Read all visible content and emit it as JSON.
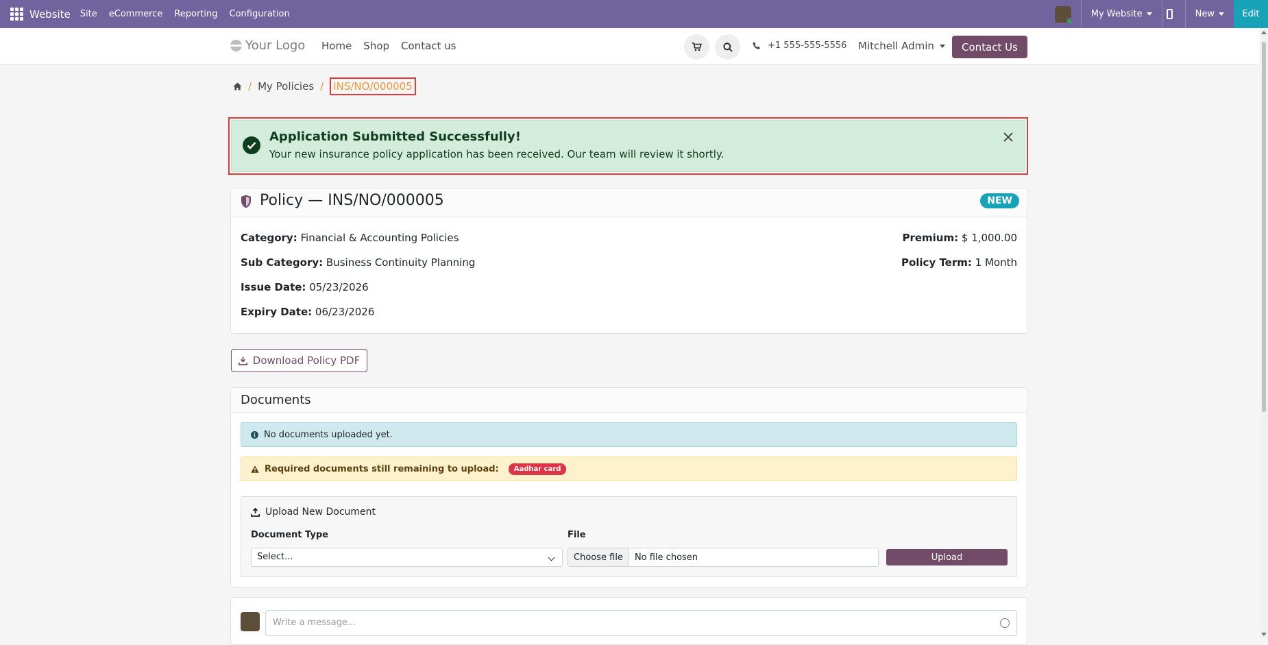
{
  "topbar": {
    "brand": "Website",
    "menu": [
      "Site",
      "eCommerce",
      "Reporting",
      "Configuration"
    ],
    "my_website": "My Website",
    "new": "New",
    "edit": "Edit",
    "bg_color": "#71639e"
  },
  "header": {
    "logo_text": "Your Logo",
    "nav": [
      "Home",
      "Shop",
      "Contact us"
    ],
    "phone": "+1 555-555-5556",
    "user": "Mitchell Admin",
    "contact_btn": "Contact Us"
  },
  "breadcrumb": {
    "items": [
      "My Policies",
      "INS/NO/000005"
    ]
  },
  "alert": {
    "title": "Application Submitted Successfully!",
    "message": "Your new insurance policy application has been received. Our team will review it shortly."
  },
  "policy": {
    "title": "Policy — INS/NO/000005",
    "status": "NEW",
    "category_label": "Category:",
    "category": "Financial & Accounting Policies",
    "sub_category_label": "Sub Category:",
    "sub_category": "Business Continuity Planning",
    "issue_date_label": "Issue Date:",
    "issue_date": "05/23/2026",
    "expiry_date_label": "Expiry Date:",
    "expiry_date": "06/23/2026",
    "premium_label": "Premium:",
    "premium": "$ 1,000.00",
    "term_label": "Policy Term:",
    "term": "1 Month"
  },
  "download_btn": "Download Policy PDF",
  "documents": {
    "title": "Documents",
    "info": "No documents uploaded yet.",
    "warning": "Required documents still remaining to upload:",
    "missing_badge": "Aadhar card",
    "upload_title": "Upload New Document",
    "doc_type_label": "Document Type",
    "doc_type_value": "Select...",
    "file_label": "File",
    "choose_file": "Choose file",
    "no_file": "No file chosen",
    "upload_btn": "Upload"
  },
  "chatter": {
    "placeholder": "Write a message..."
  }
}
